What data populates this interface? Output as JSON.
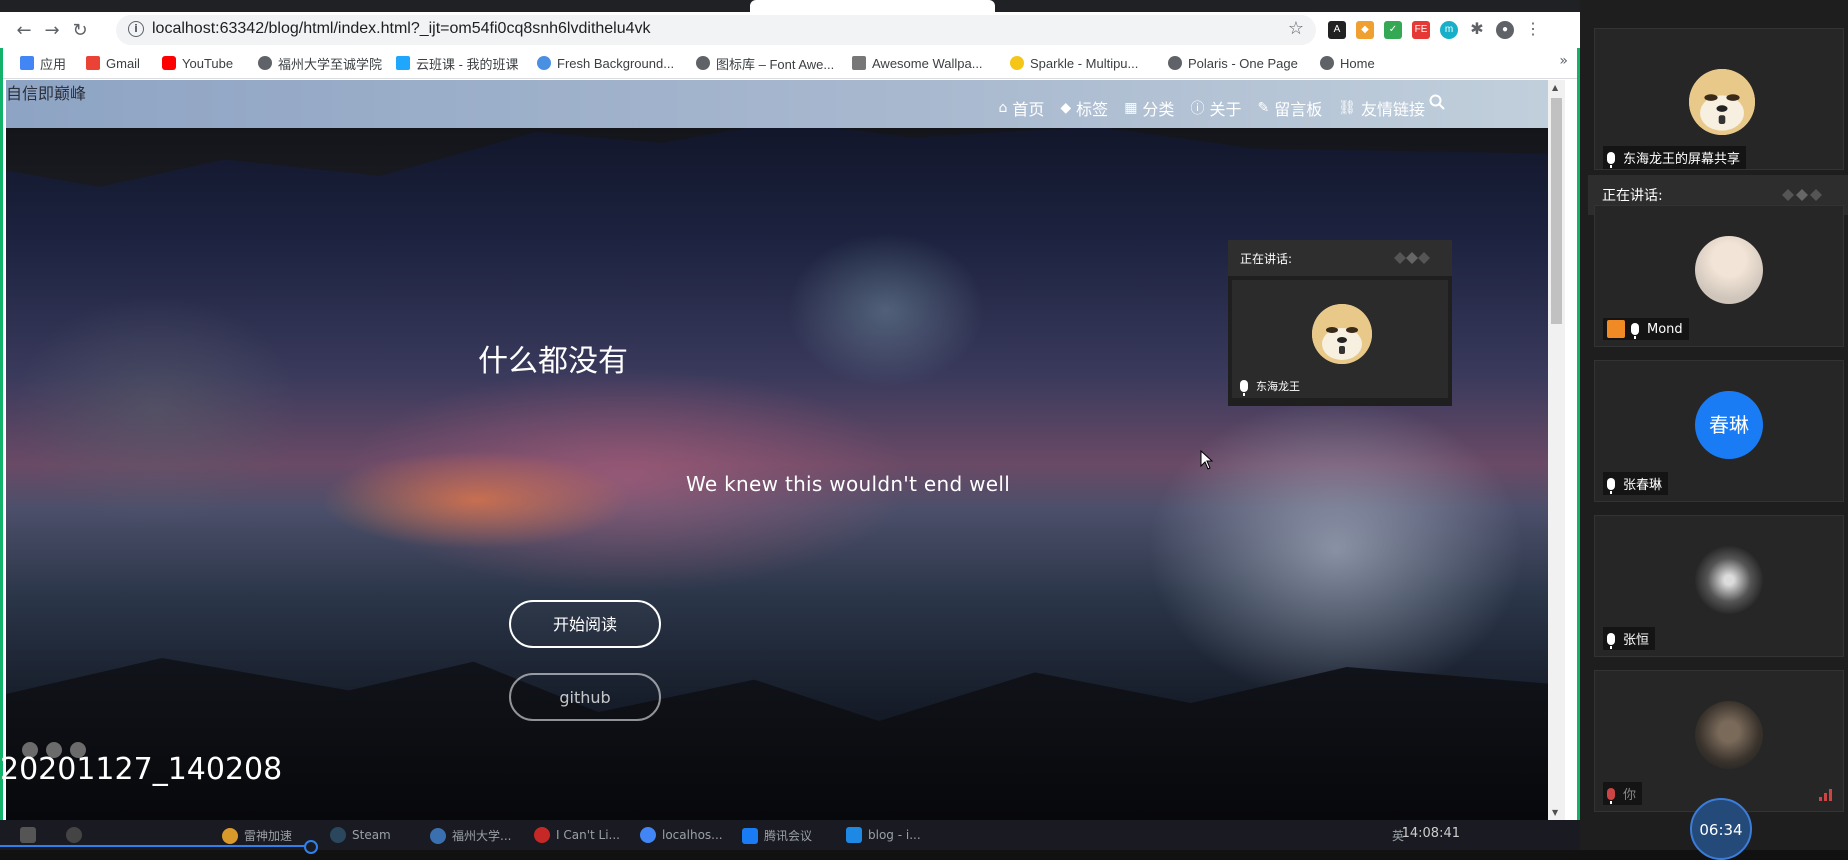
{
  "browser": {
    "url": "localhost:63342/blog/html/index.html?_ijt=om54fi0cq8snh6lvdithelu4vk",
    "bookmarks": [
      {
        "label": "应用",
        "color": "#4285f4"
      },
      {
        "label": "Gmail",
        "color": "#ea4335"
      },
      {
        "label": "YouTube",
        "color": "#ff0000"
      },
      {
        "label": "福州大学至诚学院",
        "color": "#5f6368"
      },
      {
        "label": "云班课 - 我的班课",
        "color": "#1ea7fd"
      },
      {
        "label": "Fresh Background...",
        "color": "#4a90e2"
      },
      {
        "label": "图标库 – Font Awe...",
        "color": "#5f6368"
      },
      {
        "label": "Awesome Wallpa...",
        "color": "#777777"
      },
      {
        "label": "Sparkle - Multipu...",
        "color": "#f5c518"
      },
      {
        "label": "Polaris - One Page",
        "color": "#5f6368"
      },
      {
        "label": "Home",
        "color": "#5f6368"
      }
    ],
    "bookmarks_more": "»"
  },
  "site": {
    "title": "自信即巅峰",
    "nav": [
      {
        "label": "首页",
        "icon": "home-icon",
        "glyph": "⌂"
      },
      {
        "label": "标签",
        "icon": "tag-icon",
        "glyph": "◆"
      },
      {
        "label": "分类",
        "icon": "grid-icon",
        "glyph": "▦"
      },
      {
        "label": "关于",
        "icon": "info-icon",
        "glyph": "ⓘ"
      },
      {
        "label": "留言板",
        "icon": "edit-icon",
        "glyph": "✎"
      },
      {
        "label": "友情链接",
        "icon": "link-icon",
        "glyph": "⛓"
      }
    ],
    "hero_title": "什么都没有",
    "hero_subtitle": "We knew this wouldn't end well",
    "read_button": "开始阅读",
    "github_button": "github"
  },
  "float_speaker": {
    "label": "正在讲话:",
    "name": "东海龙王"
  },
  "overlay": {
    "timestamp": "20201127_140208"
  },
  "taskbar": {
    "items": [
      "雷神加速",
      "Steam",
      "福州大学...",
      "I Can't Li...",
      "localhos...",
      "腾讯会议",
      "blog - i..."
    ],
    "ime": "英",
    "clock": "14:08:41"
  },
  "meeting": {
    "top_card_name": "东海龙王的屏幕共享",
    "speaking_label": "正在讲话:",
    "participants": [
      {
        "name": "Mond"
      },
      {
        "name": "张春琳",
        "avatar_text": "春琳"
      },
      {
        "name": "张恒"
      },
      {
        "name": "你"
      }
    ],
    "timer": "06:34"
  }
}
